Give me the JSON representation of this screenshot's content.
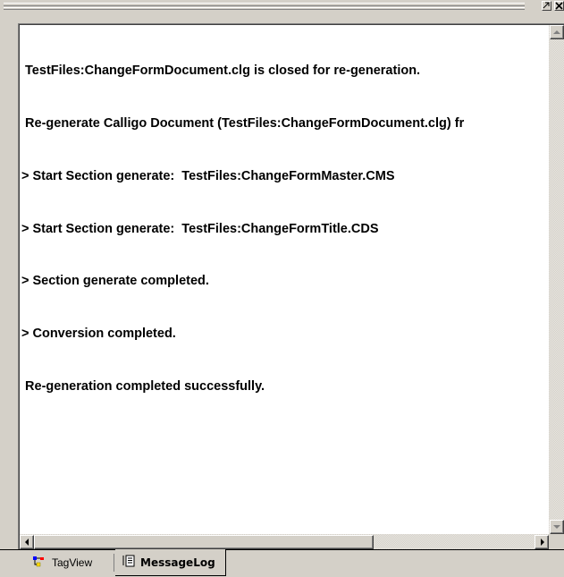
{
  "window": {
    "title": "",
    "buttons": {
      "maximize_icon": "maximize-icon",
      "close_icon": "close-icon"
    }
  },
  "message_log": {
    "lines": [
      " TestFiles:ChangeFormDocument.clg is closed for re-generation.",
      " Re-generate Calligo Document (TestFiles:ChangeFormDocument.clg) fr",
      "> Start Section generate:  TestFiles:ChangeFormMaster.CMS",
      "> Start Section generate:  TestFiles:ChangeFormTitle.CDS",
      "> Section generate completed.",
      "> Conversion completed.",
      " Re-generation completed successfully."
    ]
  },
  "tabs": [
    {
      "label": "TagView",
      "icon": "tag-tree-icon",
      "active": false
    },
    {
      "label": "MessageLog",
      "icon": "document-list-icon",
      "active": true
    }
  ],
  "colors": {
    "face": "#d4d0c8",
    "log_background": "#ffffff",
    "tag_icon_colors": [
      "#0000ff",
      "#ff0000",
      "#ffd700"
    ]
  }
}
